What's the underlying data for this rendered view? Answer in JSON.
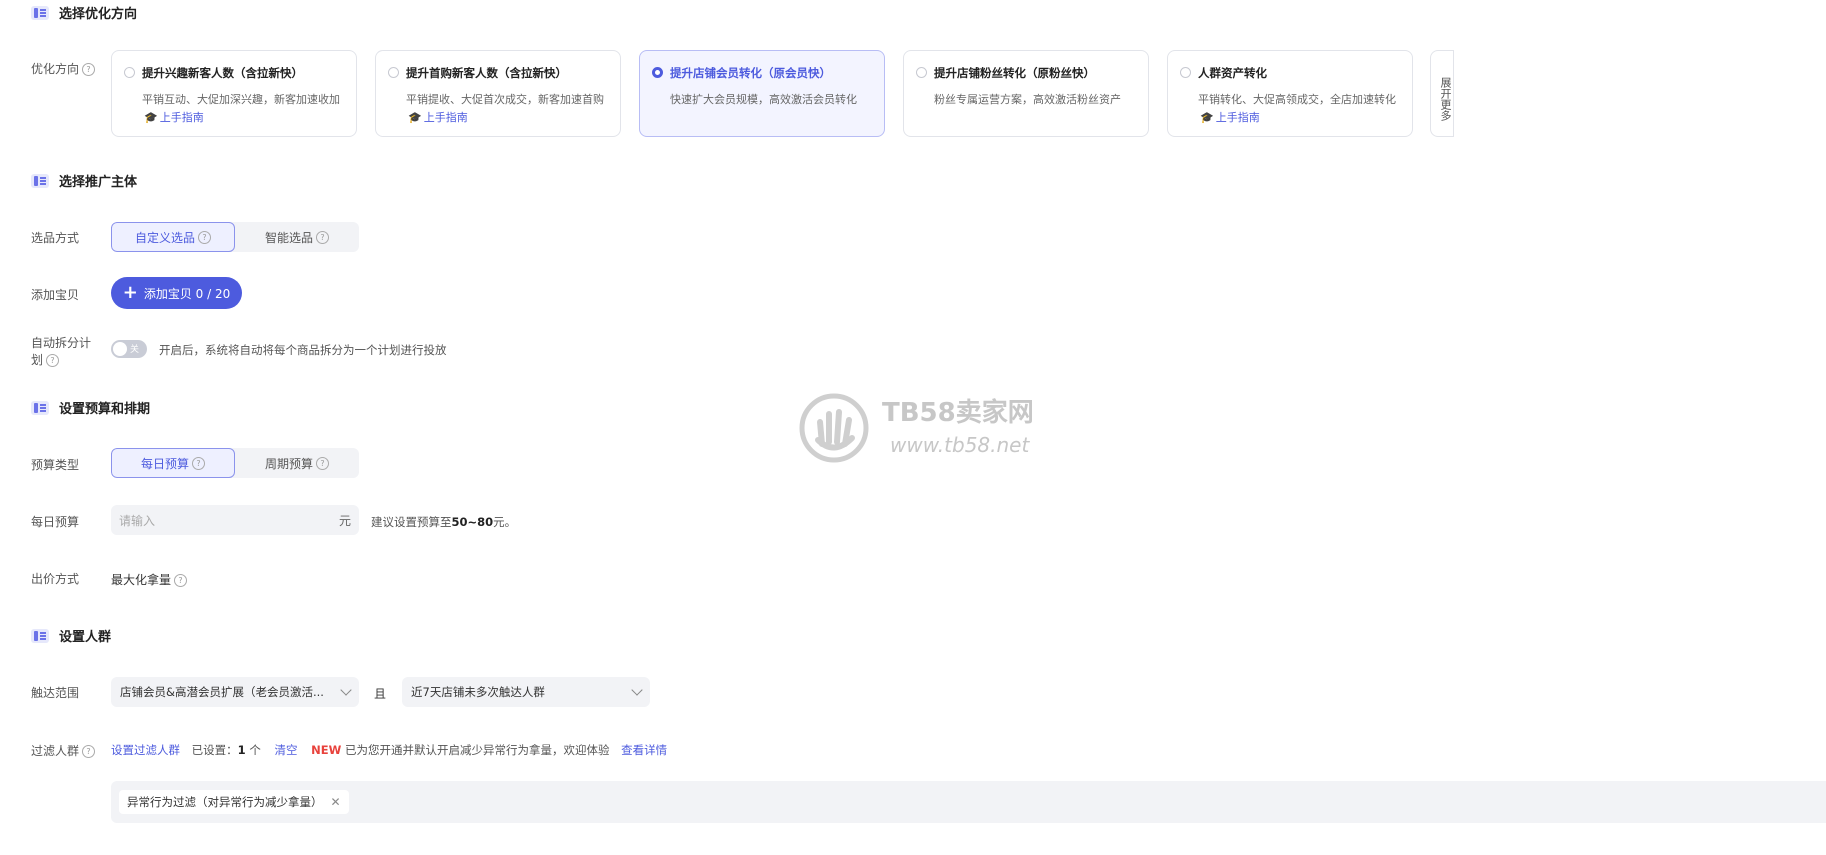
{
  "sections": {
    "direction": "选择优化方向",
    "subject": "选择推广主体",
    "budget": "设置预算和排期",
    "crowd": "设置人群"
  },
  "labels": {
    "direction": "优化方向",
    "select_method": "选品方式",
    "add_item": "添加宝贝",
    "auto_split_1": "自动拆分计",
    "auto_split_2": "划",
    "budget_type": "预算类型",
    "daily_budget": "每日预算",
    "bid_method": "出价方式",
    "reach": "触达范围",
    "filter": "过滤人群"
  },
  "cards": [
    {
      "title": "提升兴趣新客人数（含拉新快）",
      "desc": "平销互动、大促加深兴趣，新客加速收加",
      "guide": "上手指南"
    },
    {
      "title": "提升首购新客人数（含拉新快）",
      "desc": "平销提收、大促首次成交，新客加速首购",
      "guide": "上手指南"
    },
    {
      "title": "提升店铺会员转化（原会员快）",
      "desc": "快速扩大会员规模，高效激活会员转化",
      "guide": ""
    },
    {
      "title": "提升店铺粉丝转化（原粉丝快）",
      "desc": "粉丝专属运营方案，高效激活粉丝资产",
      "guide": ""
    },
    {
      "title": "人群资产转化",
      "desc": "平销转化、大促高领成交，全店加速转化",
      "guide": "上手指南"
    }
  ],
  "more": "展开更多",
  "select_method": {
    "custom": "自定义选品",
    "smart": "智能选品"
  },
  "add_button": "添加宝贝 0 / 20",
  "toggle": {
    "state": "关",
    "desc": "开启后，系统将自动将每个商品拆分为一个计划进行投放"
  },
  "budget_type": {
    "daily": "每日预算",
    "period": "周期预算"
  },
  "daily_budget": {
    "placeholder": "请输入",
    "unit": "元",
    "hint_prefix": "建议设置预算至",
    "hint_value": "50~80",
    "hint_suffix": "元。"
  },
  "bid": {
    "value": "最大化拿量"
  },
  "reach": {
    "select1": "店铺会员&高潜会员扩展（老会员激活...",
    "and": "且",
    "select2": "近7天店铺未多次触达人群"
  },
  "filter": {
    "set_link": "设置过滤人群",
    "set_label": "已设置：",
    "count": "1",
    "count_unit": "个",
    "clear": "清空",
    "new": "NEW",
    "notice": "已为您开通并默认开启减少异常行为拿量，欢迎体验",
    "detail": "查看详情",
    "tag": "异常行为过滤（对异常行为减少拿量）"
  },
  "watermark": {
    "title": "TB58卖家网",
    "url": "www.tb58.net"
  }
}
